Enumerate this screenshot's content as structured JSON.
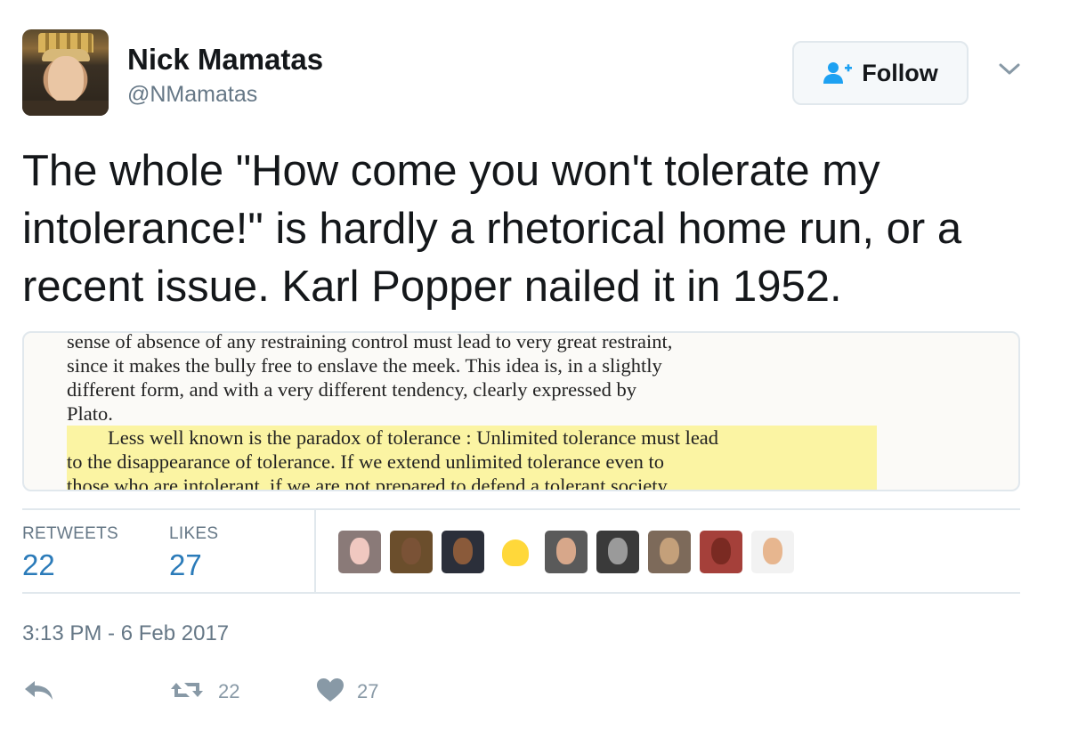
{
  "author": {
    "name": "Nick Mamatas",
    "handle": "@NMamatas"
  },
  "follow_button": {
    "label": "Follow",
    "icon": "add-user-icon"
  },
  "menu": {
    "icon": "chevron-down-icon"
  },
  "tweet": {
    "text": "The whole \"How come you won't tolerate my intolerance!\" is hardly a rhetorical home run, or a recent issue. Karl Popper nailed it in 1952."
  },
  "media": {
    "lines": [
      "sense of absence of any restraining control must lead to very great restraint,",
      "since it makes the bully free to enslave the meek.  This idea is, in a slightly",
      "different form, and with a very different tendency, clearly expressed by",
      "Plato.",
      "Less well known is the paradox of tolerance :  Unlimited tolerance must lead",
      "to the disappearance of tolerance.   If we extend unlimited tolerance even to",
      "those who are intolerant, if we are not prepared to defend a tolerant society"
    ]
  },
  "stats": {
    "retweets_label": "RETWEETS",
    "retweets": "22",
    "likes_label": "LIKES",
    "likes": "27"
  },
  "likers": [
    {
      "name": "liker-avatar-1",
      "bg": "#8a7a78"
    },
    {
      "name": "liker-avatar-2",
      "bg": "#6b4e2c"
    },
    {
      "name": "liker-avatar-3",
      "bg": "#2b2f3a"
    },
    {
      "name": "liker-avatar-4",
      "bg": "#ffffff"
    },
    {
      "name": "liker-avatar-5",
      "bg": "#5a5a5a"
    },
    {
      "name": "liker-avatar-6",
      "bg": "#3a3a3a"
    },
    {
      "name": "liker-avatar-7",
      "bg": "#7d6a5a"
    },
    {
      "name": "liker-avatar-8",
      "bg": "#a5403a"
    },
    {
      "name": "liker-avatar-9",
      "bg": "#f2f2f2"
    }
  ],
  "timestamp": "3:13 PM - 6 Feb 2017",
  "actions": {
    "reply_icon": "reply-icon",
    "retweet_icon": "retweet-icon",
    "retweet_count": "22",
    "like_icon": "heart-icon",
    "like_count": "27"
  },
  "colors": {
    "accent": "#1b95e0",
    "muted": "#657786",
    "highlight": "#fbf4a3"
  }
}
